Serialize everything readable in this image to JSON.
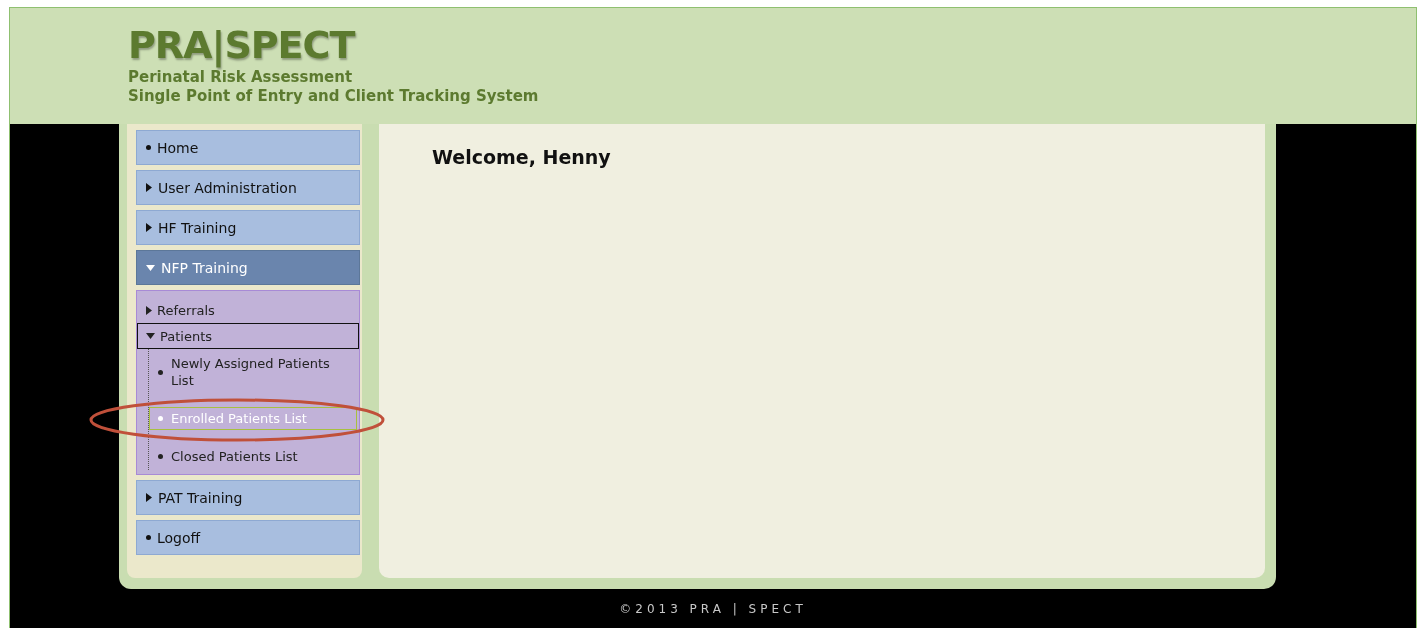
{
  "header": {
    "logo": "PRA|SPECT",
    "subtitle": [
      "Perinatal Risk Assessment",
      "Single Point of Entry and Client Tracking System"
    ]
  },
  "sidebar": {
    "items": [
      {
        "label": "Home",
        "kind": "leaf"
      },
      {
        "label": "User Administration",
        "kind": "group",
        "expanded": false
      },
      {
        "label": "HF Training",
        "kind": "group",
        "expanded": false
      },
      {
        "label": "NFP Training",
        "kind": "group",
        "expanded": true,
        "children": [
          {
            "label": "Referrals",
            "expanded": false,
            "selected": false
          },
          {
            "label": "Patients",
            "expanded": true,
            "selected": true,
            "children": [
              {
                "label": "Newly Assigned Patients List",
                "selected": false
              },
              {
                "label": "Enrolled Patients List",
                "selected": true
              },
              {
                "label": "Closed Patients List",
                "selected": false
              }
            ]
          }
        ]
      },
      {
        "label": "PAT Training",
        "kind": "group",
        "expanded": false
      },
      {
        "label": "Logoff",
        "kind": "leaf"
      }
    ]
  },
  "main": {
    "heading": "Welcome, Henny"
  },
  "footer": {
    "copyright": "©2013 PRA | SPECT"
  }
}
